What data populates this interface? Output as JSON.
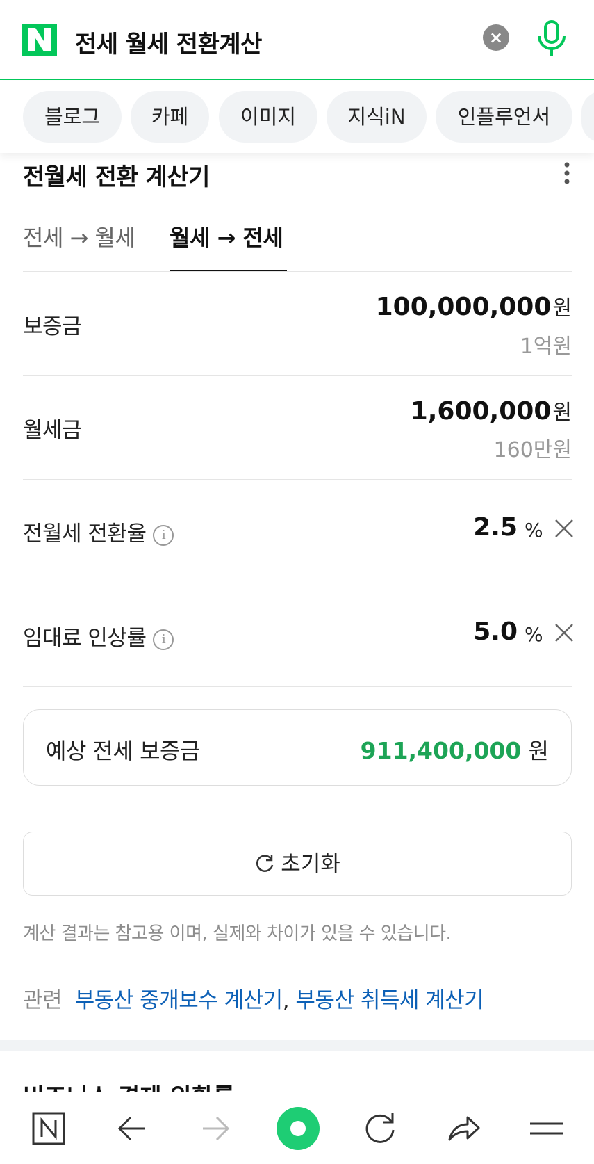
{
  "search": {
    "logo_letter": "N",
    "query": "전세 월세 전환계산",
    "clear_label": "×"
  },
  "chips": [
    {
      "label": "블로그"
    },
    {
      "label": "카페"
    },
    {
      "label": "이미지"
    },
    {
      "label": "지식iN"
    },
    {
      "label": "인플루언서"
    }
  ],
  "calculator": {
    "title": "전월세 전환 계산기",
    "tabs": [
      {
        "label": "전세 → 월세",
        "active": false
      },
      {
        "label": "월세 → 전세",
        "active": true
      }
    ],
    "deposit": {
      "label": "보증금",
      "value": "100,000,000",
      "unit": "원",
      "sub": "1억원"
    },
    "monthly_rent": {
      "label": "월세금",
      "value": "1,600,000",
      "unit": "원",
      "sub": "160만원"
    },
    "conversion_rate": {
      "label": "전월세 전환율",
      "value": "2.5",
      "unit": "%"
    },
    "rent_increase": {
      "label": "임대료 인상률",
      "value": "5.0",
      "unit": "%"
    },
    "result": {
      "label": "예상 전세 보증금",
      "value": "911,400,000",
      "unit": "원"
    },
    "reset_label": "초기화",
    "disclaimer": "계산 결과는 참고용 이며, 실제와 차이가 있을 수 있습니다.",
    "related": {
      "label": "관련",
      "links": [
        "부동산 중개보수 계산기",
        "부동산 취득세 계산기"
      ],
      "separator": ","
    }
  },
  "next_section_title": "비즈니스 경제 외환률",
  "colors": {
    "brand_green": "#03c75a",
    "result_green": "#1da456",
    "link_blue": "#0c60b6"
  },
  "bottom_nav": [
    {
      "icon": "naver-home-icon"
    },
    {
      "icon": "back-arrow-icon"
    },
    {
      "icon": "forward-arrow-icon"
    },
    {
      "icon": "green-dot-icon"
    },
    {
      "icon": "refresh-icon"
    },
    {
      "icon": "share-icon"
    },
    {
      "icon": "menu-icon"
    }
  ]
}
